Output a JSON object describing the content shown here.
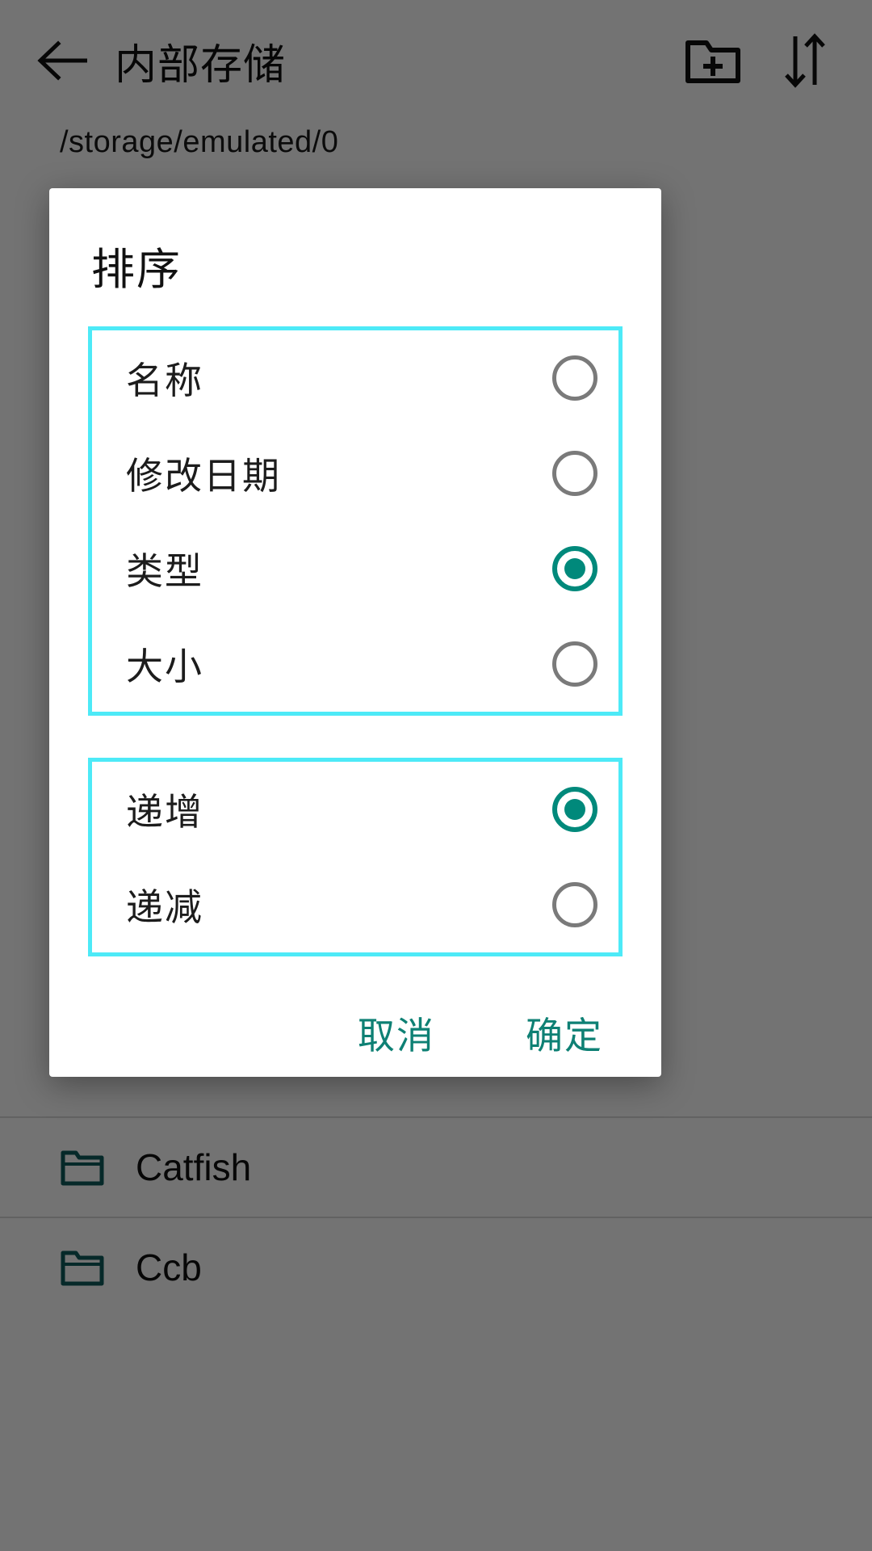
{
  "app": {
    "header": {
      "back_icon": "back-arrow-icon",
      "title": "内部存储",
      "new_folder_icon": "new-folder-icon",
      "sort_icon": "sort-arrows-icon"
    },
    "path": "/storage/emulated/0",
    "files": [
      {
        "icon": "folder-icon",
        "name": "Catfish"
      },
      {
        "icon": "folder-icon",
        "name": "Ccb"
      }
    ]
  },
  "dialog": {
    "title": "排序",
    "sort_by_group": {
      "options": [
        {
          "label": "名称",
          "selected": false
        },
        {
          "label": "修改日期",
          "selected": false
        },
        {
          "label": "类型",
          "selected": true
        },
        {
          "label": "大小",
          "selected": false
        }
      ]
    },
    "order_group": {
      "options": [
        {
          "label": "递增",
          "selected": true
        },
        {
          "label": "递减",
          "selected": false
        }
      ]
    },
    "cancel_label": "取消",
    "confirm_label": "确定"
  },
  "colors": {
    "accent_teal": "#00897B",
    "button_teal": "#0E8074",
    "highlight_cyan": "#4DEAF7",
    "radio_unselected": "#7a7a7a"
  }
}
